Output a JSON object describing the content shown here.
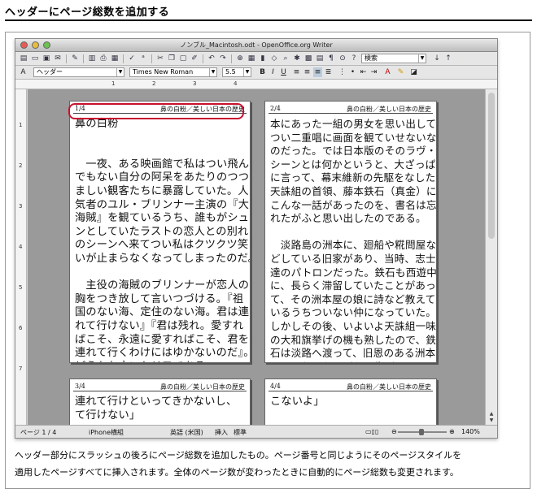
{
  "heading": "ヘッダーにページ総数を追加する",
  "window": {
    "title": "ノンブル_Macintosh.odt - OpenOffice.org Writer"
  },
  "toolbar": {
    "search_value": "検索"
  },
  "format_bar": {
    "style": "ヘッダー",
    "font": "Times New Roman",
    "size": "5.5"
  },
  "ruler": {
    "h_ticks": [
      "1",
      "2",
      "3",
      "4"
    ],
    "v_ticks": [
      "1",
      "2",
      "3",
      "4",
      "5",
      "6",
      "7"
    ]
  },
  "pages": [
    {
      "num": "1/4",
      "header_title": "鼻の白粉／美しい日本の歴史",
      "text": "鼻の白粉\n\n\n　一夜、ある映画館で私はつい飛ん\nでもない自分の阿呆をあたりのつつ\nましい観客たちに暴露していた。人\n気者のユル・ブリンナー主演の『大\n海賊』を観ているうち、誰もがシュ\nンとしていたラストの恋人との別れ\nのシーンへ来てつい私はクツクツ笑\nいが止まらなくなってしまったのだ。\n\n　主役の海賊のブリンナーが恋人の\n胸をつき放して言いつづける。『祖\n国のない海、定住のない海。君は連\nれて行けない』『君は残れ。愛すれ\nばこそ、永遠に愛すればこそ、君を\n連れて行くわけにはゆかないのだ』。\nどうもお古いセリフである。\n\n　だが私は、それでおかしくなった\nわけではない。ちょうど時代もこの\n映画が扱っている十八世紀ごろの日"
    },
    {
      "num": "2/4",
      "header_title": "鼻の白粉／美しい日本の歴史",
      "text": "本にあった一組の男女を思い出して、\nつい二重唱に画面を観ていせないな\nのだった。では日本版のそのラヴ・\nシーンとは何かというと、大ざっぱ\nに言って、幕末維新の先駆をなした\n天誅組の首領、藤本鉄石（真金）に\nこんな一話があったのを、書名は忘\nれたがふと思い出したのである。\n\n　淡路島の洲本に、廻船や糀問屋な\nどしている旧家があり、当時、志士\n達のパトロンだった。鉄石も西遊中\nに、長らく滞留していたことがあっ\nて、その洲本屋の娘に詩など教えて\nいるうちついない仲になっていた。\nしかしその後、いよいよ天誅組一味\nの大和旗挙げの機も熟したので、鉄\n石は淡路へ渡って、旧恩のある洲本\n屋へそれとなく別れを告げ、そして\n一晩はそこに泊った。\n\n　すると翌朝、いざ立ち際になると、\n前夜は得心していたはずの娘が俄に\n泣きみだれて、どうしても一しょに"
    },
    {
      "num": "3/4",
      "header_title": "鼻の白粉／美しい日本の歴史",
      "text": "連れて行けといってきかないし、\nて行けない」"
    },
    {
      "num": "4/4",
      "header_title": "鼻の白粉／美しい日本の歴史",
      "text": "こないよ」"
    }
  ],
  "statusbar": {
    "page": "ページ 1 / 4",
    "style": "iPhone横組",
    "lang": "英語 (米国)",
    "mode": "挿入",
    "sel": "標準",
    "zoom": "140%"
  },
  "caption": {
    "line1": "ヘッダー部分にスラッシュの後ろにページ総数を追加したもの。ページ番号と同じようにそのページスタイルを",
    "line2": "適用したページすべてに挿入されます。全体のページ数が変わったときに自動的にページ総数も変更されます。"
  },
  "colors": {
    "highlight": "#c8102e",
    "workspace": "#9a9a9a"
  }
}
